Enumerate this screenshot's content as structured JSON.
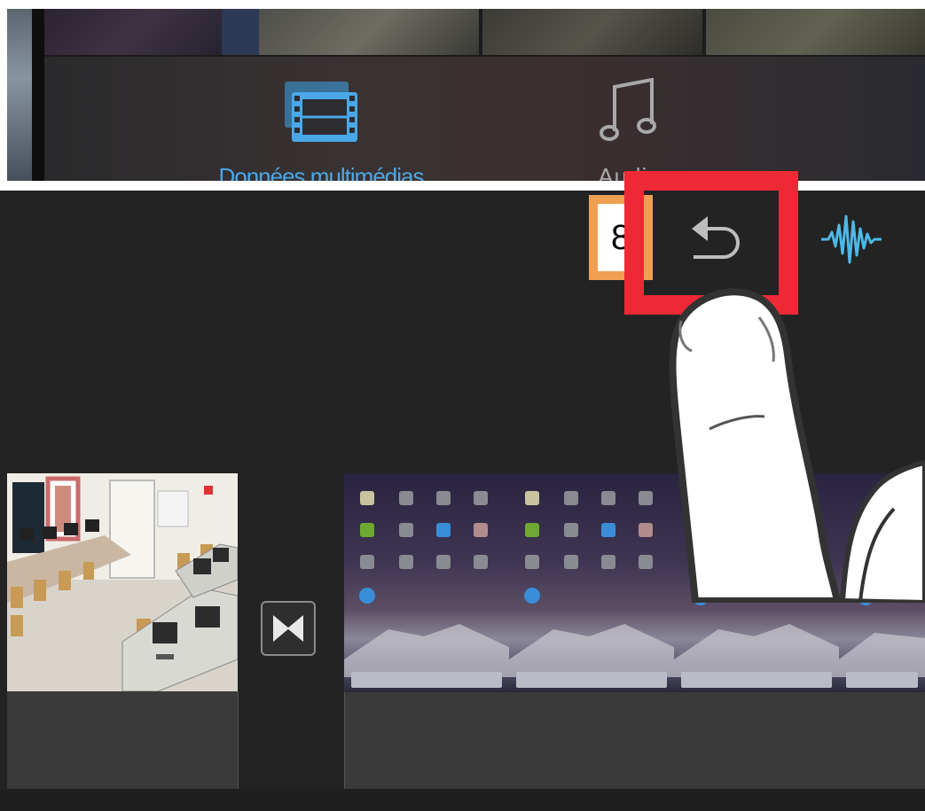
{
  "tabs": [
    {
      "label": "Données multimédias",
      "icon": "film-icon",
      "active": true,
      "color": "#4aa8e8"
    },
    {
      "label": "Audio",
      "icon": "music-note-icon",
      "active": false,
      "color": "#a9a9a9"
    }
  ],
  "step_badge": {
    "label": "8",
    "color": "#f0a052"
  },
  "highlight": {
    "color": "#ee2936"
  },
  "toolbar": {
    "undo_icon": "undo-icon",
    "audio_waveform_icon": "waveform-icon",
    "accent": "#4fb8e8"
  },
  "timeline": {
    "clips": [
      {
        "name": "classroom-clip"
      },
      {
        "name": "ipad-homescreen-clip",
        "frames": 4
      }
    ],
    "transition_icon": "bowtie-transition-icon"
  },
  "overlay": {
    "hand_icon": "pointing-finger-icon"
  }
}
